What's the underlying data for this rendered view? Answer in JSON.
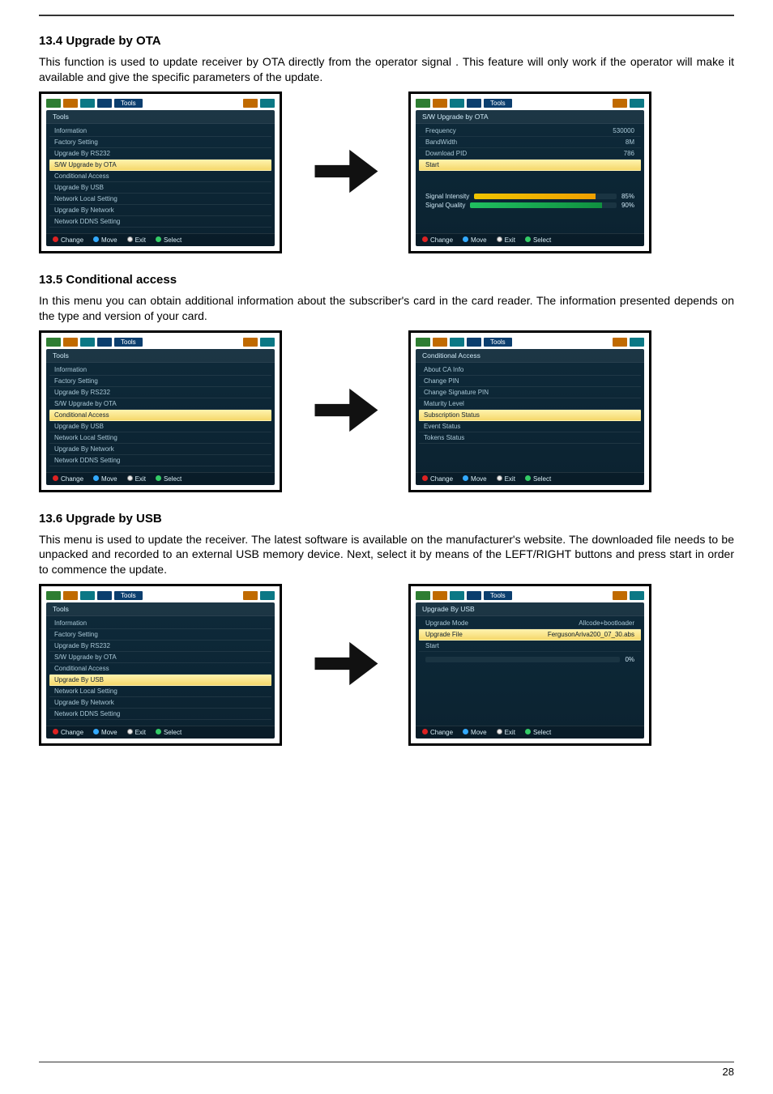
{
  "page_number": "28",
  "sections": [
    {
      "heading": "13.4 Upgrade by OTA",
      "body": "This function is used to update receiver by OTA directly from the operator signal . This feature will only work if the operator will make it available and give the specific parameters of the update."
    },
    {
      "heading": "13.5 Conditional access",
      "body": "In this menu you can obtain additional information about the subscriber's card in the card reader. The information presented depends on the type and version of your card."
    },
    {
      "heading": "13.6 Upgrade by USB",
      "body": "This menu is used to update the receiver. The latest software is available on the manufacturer's website. The downloaded file needs to be unpacked and recorded to an external USB memory device. Next, select it by means of the LEFT/RIGHT buttons and press start in order to commence the update."
    }
  ],
  "header_tab_label": "Tools",
  "tools_menu": {
    "title": "Tools",
    "items": [
      "Information",
      "Factory Setting",
      "Upgrade By RS232",
      "S/W Upgrade by OTA",
      "Conditional Access",
      "Upgrade By USB",
      "Network Local Setting",
      "Upgrade By Network",
      "Network DDNS Setting"
    ],
    "selected_for_section": {
      "ota": "S/W Upgrade by OTA",
      "ca": "Conditional Access",
      "usb": "Upgrade By USB"
    }
  },
  "ota_screen": {
    "title": "S/W Upgrade by OTA",
    "rows": [
      {
        "label": "Frequency",
        "value": "530000"
      },
      {
        "label": "BandWidth",
        "value": "8M"
      },
      {
        "label": "Download PID",
        "value": "786"
      },
      {
        "label": "Start",
        "value": ""
      }
    ],
    "signal": [
      {
        "label": "Signal Intensity",
        "pct": "85%"
      },
      {
        "label": "Signal Quality",
        "pct": "90%"
      }
    ]
  },
  "ca_screen": {
    "title": "Conditional Access",
    "items": [
      "About CA Info",
      "Change PIN",
      "Change Signature PIN",
      "Maturity Level",
      "Subscription Status",
      "Event Status",
      "Tokens Status"
    ],
    "selected": "Subscription Status"
  },
  "usb_screen": {
    "title": "Upgrade By USB",
    "rows": [
      {
        "label": "Upgrade Mode",
        "value": "Allcode+bootloader"
      },
      {
        "label": "Upgrade File",
        "value": "FergusonAriva200_07_30.abs"
      },
      {
        "label": "Start",
        "value": ""
      }
    ],
    "progress_pct": "0%"
  },
  "footer_actions": {
    "change": "Change",
    "move": "Move",
    "exit": "Exit",
    "select": "Select"
  }
}
